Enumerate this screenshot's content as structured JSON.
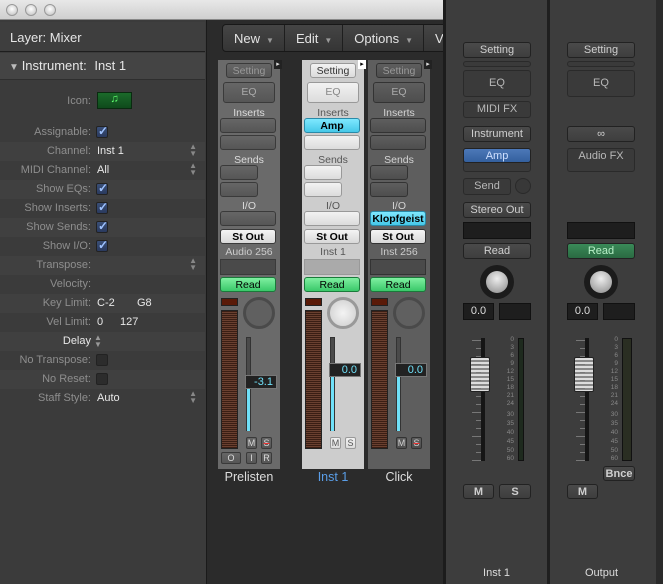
{
  "window": {
    "controls": [
      "close",
      "minimize",
      "zoom"
    ]
  },
  "inspector": {
    "layer": "Layer: Mixer",
    "object_type": "Instrument:",
    "object_name": "Inst 1",
    "icon_label": "Icon:",
    "icon": "music-note-icon",
    "rows": [
      {
        "label": "Assignable:",
        "type": "check",
        "checked": true
      },
      {
        "label": "Channel:",
        "value": "Inst 1",
        "stepper": true
      },
      {
        "label": "MIDI Channel:",
        "value": "All",
        "stepper": true
      },
      {
        "label": "Show EQs:",
        "type": "check",
        "checked": true
      },
      {
        "label": "Show Inserts:",
        "type": "check",
        "checked": true
      },
      {
        "label": "Show Sends:",
        "type": "check",
        "checked": true
      },
      {
        "label": "Show I/O:",
        "type": "check",
        "checked": true
      },
      {
        "label": "Transpose:",
        "value": "",
        "stepper": true
      },
      {
        "label": "Velocity:",
        "value": ""
      },
      {
        "label": "Key Limit:",
        "value": "C-2",
        "value2": "G8"
      },
      {
        "label": "Vel Limit:",
        "value": "0",
        "value2": "127"
      },
      {
        "label": "Delay",
        "type": "popup"
      },
      {
        "label": "No Transpose:",
        "type": "check",
        "checked": false
      },
      {
        "label": "No Reset:",
        "type": "check",
        "checked": false
      },
      {
        "label": "Staff Style:",
        "value": "Auto",
        "stepper": true
      }
    ]
  },
  "toolbar": {
    "menus": [
      "New",
      "Edit",
      "Options",
      "Vie"
    ]
  },
  "strips": [
    {
      "name": "Prelisten",
      "setting": "Setting",
      "eq": "EQ",
      "inserts_label": "Inserts",
      "inserts": [
        "",
        ""
      ],
      "sends_label": "Sends",
      "io_label": "I/O",
      "input": "",
      "output": "St Out",
      "channel": "Audio 256",
      "automation": "Read",
      "volume": "-3.1",
      "volume_level": 0.55,
      "mute": "M",
      "solo": "S",
      "solo_disabled": true,
      "extra_buttons": [
        "O",
        "I",
        "R"
      ],
      "selected": false
    },
    {
      "name": "Inst 1",
      "setting": "Setting",
      "eq": "EQ",
      "inserts_label": "Inserts",
      "inserts": [
        "Amp",
        ""
      ],
      "sends_label": "Sends",
      "io_label": "I/O",
      "input": "",
      "output": "St Out",
      "channel": "Inst 1",
      "automation": "Read",
      "volume": "0.0",
      "volume_level": 0.68,
      "mute": "M",
      "solo": "S",
      "solo_disabled": false,
      "extra_buttons": [],
      "selected": true
    },
    {
      "name": "Click",
      "setting": "Setting",
      "eq": "EQ",
      "inserts_label": "Inserts",
      "inserts": [
        "",
        ""
      ],
      "sends_label": "Sends",
      "io_label": "I/O",
      "input": "Klopfgeist",
      "output": "St Out",
      "channel": "Inst 256",
      "automation": "Read",
      "volume": "0.0",
      "volume_level": 0.68,
      "mute": "M",
      "solo": "S",
      "solo_disabled": true,
      "extra_buttons": [],
      "selected": false
    }
  ],
  "channel_strips": {
    "inst": {
      "name": "Inst 1",
      "setting": "Setting",
      "eq": "EQ",
      "midi_fx": "MIDI FX",
      "instrument": "Instrument",
      "insert": "Amp",
      "send": "Send",
      "output": "Stereo Out",
      "automation": "Read",
      "volume": "0.0",
      "mute": "M",
      "solo": "S"
    },
    "output": {
      "name": "Output",
      "setting": "Setting",
      "eq": "EQ",
      "link": "link-icon",
      "audio_fx": "Audio FX",
      "automation": "Read",
      "volume": "0.0",
      "bounce": "Bnce",
      "mute": "M"
    },
    "meter_scale": [
      "0",
      "3",
      "6",
      "9",
      "12",
      "15",
      "18",
      "21",
      "24",
      "30",
      "35",
      "40",
      "45",
      "50",
      "60"
    ]
  },
  "colors": {
    "read_green": "#3fcf6f",
    "insert_cyan": "#5fd8f0",
    "selected_name": "#5a9ee8",
    "output_read": "#2f7a4a",
    "amp_blue": "#3f6aa8"
  }
}
